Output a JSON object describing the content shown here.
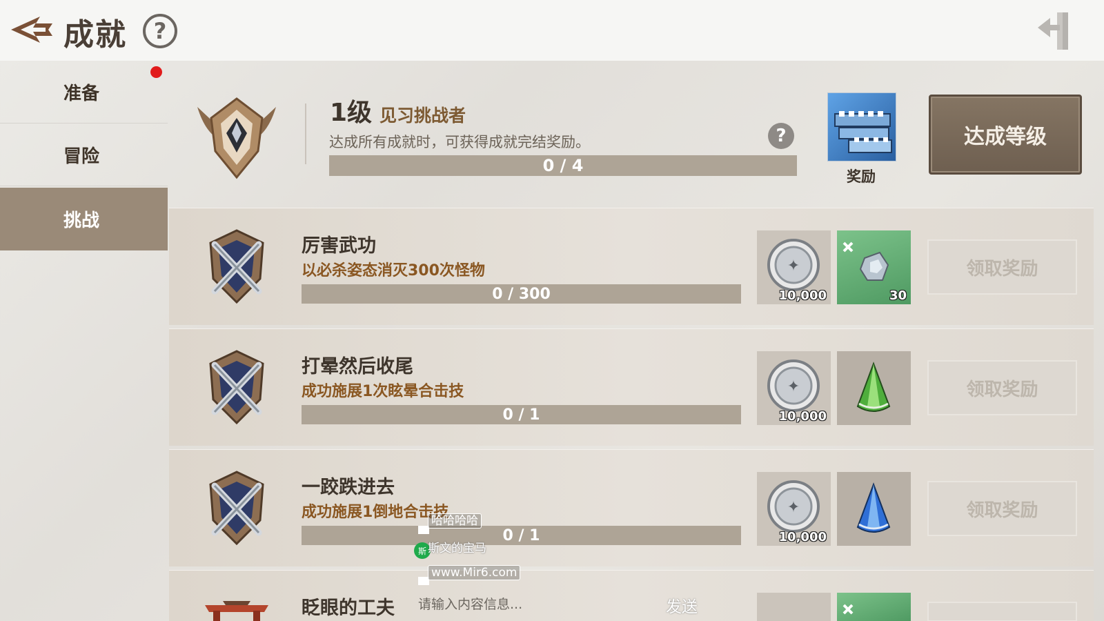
{
  "header": {
    "title": "成就",
    "help_symbol": "?"
  },
  "sidebar": {
    "items": [
      {
        "label": "准备",
        "active": false,
        "has_notification": true
      },
      {
        "label": "冒险",
        "active": false
      },
      {
        "label": "挑战",
        "active": true
      }
    ]
  },
  "level": {
    "number": "1级",
    "name": "见习挑战者",
    "description": "达成所有成就时，可获得成就完结奖励。",
    "progress_text": "0 / 4",
    "progress_fraction": 0,
    "help_symbol": "?",
    "reward_label": "奖励",
    "reach_button": "达成等级"
  },
  "achievements": [
    {
      "title": "厉害武功",
      "description": "以必杀姿态消灭300次怪物",
      "progress_text": "0 / 300",
      "progress_fraction": 0,
      "coin_amount": "10,000",
      "item_icon": "crystal-ore-icon",
      "item_qty": "30",
      "item_bg": "green",
      "claim_label": "领取奖励"
    },
    {
      "title": "打晕然后收尾",
      "description": "成功施展1次眩晕合击技",
      "progress_text": "0 / 1",
      "progress_fraction": 0,
      "coin_amount": "10,000",
      "item_icon": "green-cone-icon",
      "item_qty": "",
      "item_bg": "gray",
      "claim_label": "领取奖励"
    },
    {
      "title": "一跤跌进去",
      "description": "成功施展1倒地合击技",
      "progress_text": "0 / 1",
      "progress_fraction": 0,
      "coin_amount": "10,000",
      "item_icon": "blue-cone-icon",
      "item_qty": "",
      "item_bg": "gray",
      "claim_label": "领取奖励"
    },
    {
      "title": "眨眼的工夫",
      "description": "",
      "progress_text": "",
      "progress_fraction": 0,
      "coin_amount": "",
      "item_icon": "crystal-ore-icon",
      "item_qty": "",
      "item_bg": "green",
      "claim_label": ""
    }
  ],
  "chat_overlay": {
    "message1": "哈哈哈哈",
    "avatar_text": "斯",
    "user_name": "斯文的宝马",
    "message2": "www.Mir6.com",
    "input_placeholder": "请输入内容信息...",
    "send_label": "发送"
  },
  "colors": {
    "accent_title": "#7d5a32",
    "desc_orange": "#8a5722",
    "active_tab": "#9a8a78",
    "notification": "#e11b1b"
  }
}
